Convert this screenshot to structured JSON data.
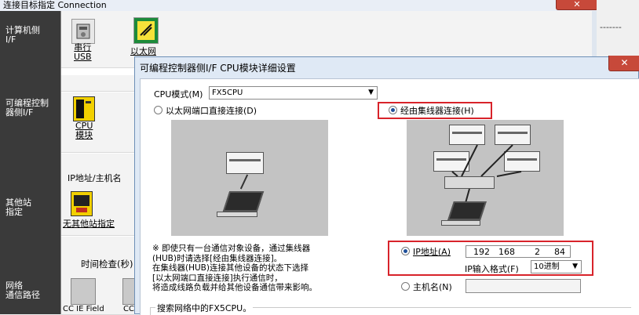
{
  "back_window": {
    "title": "连接目标指定 Connection",
    "close_glyph": "✕",
    "dash_text": "-------",
    "sidebar": {
      "pc_side": "计算机侧\nI/F",
      "plc_side": "可编程控制\n器侧I/F",
      "other_station": "其他站\n指定",
      "network_route": "网络\n通信路径"
    },
    "pc_icons": [
      {
        "label": "串行\nUSB"
      },
      {
        "label": "以太网"
      }
    ],
    "cpu_module_label": "CPU\n模块",
    "ip_host_label": "IP地址/主机名",
    "no_other_station_label": "无其他站指定",
    "time_check_label": "时间检查(秒)",
    "network_items": [
      {
        "label": "CC IE Field"
      },
      {
        "label": "CC"
      }
    ]
  },
  "dialog": {
    "title": "可编程控制器侧I/F CPU模块详细设置",
    "close_glyph": "✕",
    "cpu_mode_label": "CPU模式(M)",
    "cpu_mode_value": "FX5CPU",
    "radio_direct": "以太网端口直接连接(D)",
    "radio_hub": "经由集线器连接(H)",
    "selected_connection": "hub",
    "note": "※ 即使只有一台通信对象设备，通过集线器\n(HUB)时请选择[经由集线器连接]。\n在集线器(HUB)连接其他设备的状态下选择\n[以太网端口直接连接]执行通信时，\n将造成线路负载并给其他设备通信带来影响。",
    "ip_address_label": "IP地址(A)",
    "ip_octets": [
      "192",
      "168",
      "2",
      "84"
    ],
    "ip_format_label": "IP输入格式(F)",
    "ip_format_value": "10进制",
    "hostname_label": "主机名(N)",
    "hostname_value": "",
    "search_group_label": "搜索网络中的FX5CPU。",
    "highlight_color": "#d8232a"
  }
}
